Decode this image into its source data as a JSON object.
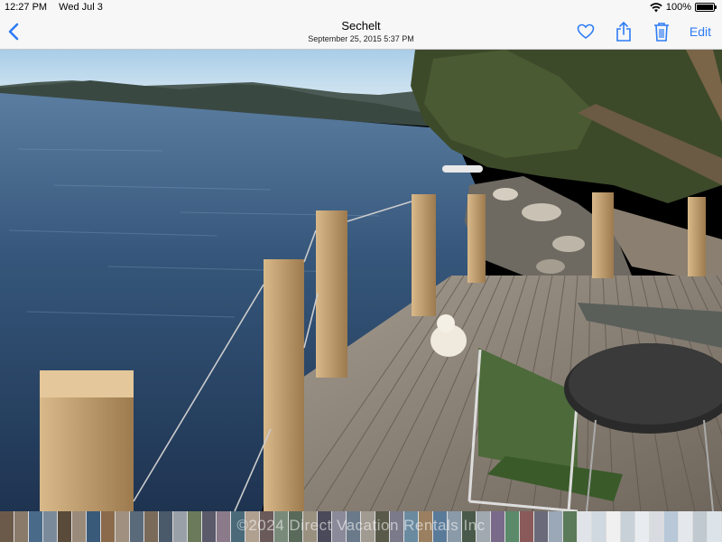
{
  "status_bar": {
    "time": "12:27 PM",
    "date": "Wed Jul 3",
    "battery": "100%",
    "battery_level": 1.0
  },
  "nav": {
    "title": "Sechelt",
    "subtitle": "September 25, 2015  5:37 PM",
    "edit_label": "Edit",
    "back_icon": "chevron-left-icon",
    "favorite_icon": "heart-icon",
    "share_icon": "share-icon",
    "delete_icon": "trash-icon"
  },
  "colors": {
    "accent": "#2e7cf6",
    "bar_background": "#f7f7f7"
  },
  "filmstrip": {
    "thumbnail_colors": [
      "#6b5a4a",
      "#8a7a6a",
      "#4a6a8a",
      "#7a8a9a",
      "#5a4a3a",
      "#9a8a7a",
      "#3a5a7a",
      "#8a6a4a",
      "#a09080",
      "#5a6a7a",
      "#7a6a5a",
      "#4a5a6a",
      "#9aa0a8",
      "#6a7a5a",
      "#5a5a6a",
      "#8a7a8a",
      "#4a6a7a",
      "#b0a090",
      "#6a5a5a",
      "#7a8a7a",
      "#5a6a5a",
      "#9a9080",
      "#4a4a5a",
      "#8a8a9a",
      "#6a7a8a",
      "#a09a90",
      "#5a5a4a",
      "#7a7a8a",
      "#6a8aa0",
      "#9a8060",
      "#5a7a9a",
      "#8a9aa8",
      "#4a5a4a",
      "#a0a8b0",
      "#7a6a8a",
      "#5a8a6a",
      "#8a5a5a",
      "#6a6a7a",
      "#9aa8b8",
      "#5a7a5a",
      "#e0e4e8",
      "#d0d8e0",
      "#f0f0f0",
      "#c8d0d8",
      "#e8ecf0",
      "#d8dce0",
      "#b8c8d8",
      "#e4e8ec",
      "#c0c8d0",
      "#dce4ea"
    ],
    "watermark": "©2024 Direct Vacation Rentals Inc"
  }
}
